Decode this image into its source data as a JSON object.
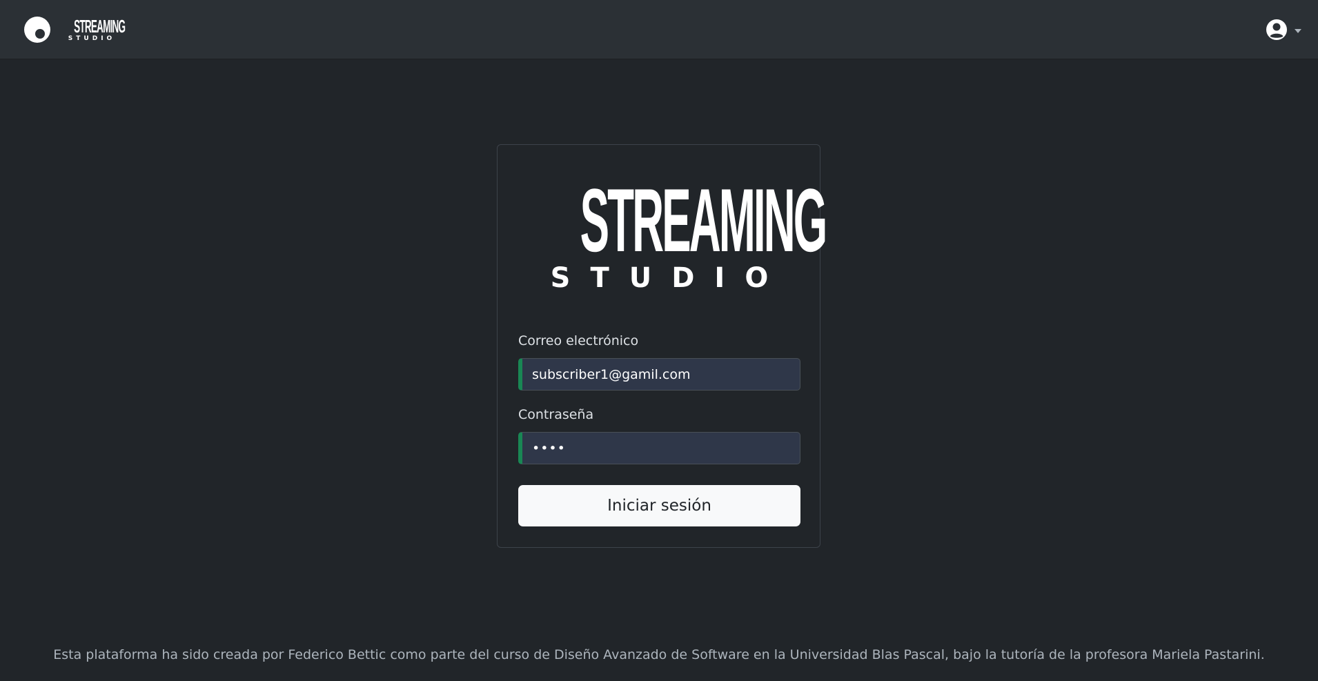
{
  "navbar": {
    "brand_wordmark": "STREAMING",
    "brand_subtitle": "STUDIO",
    "user_icon": "user-circle-icon",
    "caret_icon": "caret-down-icon"
  },
  "login_card": {
    "logo_wordmark": "STREAMING",
    "logo_subtitle": "STUDIO",
    "email_label": "Correo electrónico",
    "email_value": "subscriber1@gamil.com",
    "password_label": "Contraseña",
    "password_value": "••••",
    "submit_label": "Iniciar sesión"
  },
  "footer": {
    "text": "Esta plataforma ha sido creada por Federico Bettic como parte del curso de Diseño Avanzado de Software en la Universidad Blas Pascal, bajo la tutoría de la profesora Mariela Pastarini."
  },
  "colors": {
    "background": "#212529",
    "navbar": "#2b3035",
    "input_background": "#2f3749",
    "valid_accent": "#198754",
    "button_background": "#f8f9fa"
  }
}
